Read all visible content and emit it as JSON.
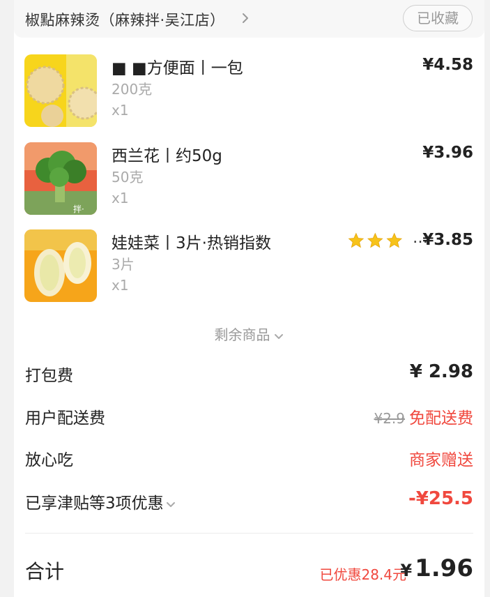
{
  "store": {
    "name": "椒點麻辣烫（麻辣拌·吴江店）",
    "favorite_label": "已收藏"
  },
  "items": [
    {
      "title": "■ ■方便面丨一包",
      "spec": "200克",
      "qty": "x1",
      "price": "¥4.58"
    },
    {
      "title": "西兰花丨约50g",
      "spec": "50克",
      "qty": "x1",
      "price": "¥3.96",
      "thumb_text": "拌·"
    },
    {
      "title": "娃娃菜丨3片·热销指数",
      "spec": "3片",
      "qty": "x1",
      "price": "¥3.85",
      "rating_ellipsis": "…"
    }
  ],
  "more_label": "剩余商品",
  "fees": [
    {
      "label": "打包费",
      "value": "¥ 2.98"
    },
    {
      "label": "用户配送费",
      "original": "¥2.9",
      "value": "免配送费"
    },
    {
      "label": "放心吃",
      "value": "商家赠送"
    },
    {
      "label": "已享津贴等3项优惠",
      "value": "-¥25.5"
    }
  ],
  "total": {
    "label": "合计",
    "saved": "已优惠28.4元",
    "currency": "¥",
    "amount": "1.96"
  },
  "colors": {
    "accent_red": "#f0483e",
    "star": "#f7c31a"
  }
}
